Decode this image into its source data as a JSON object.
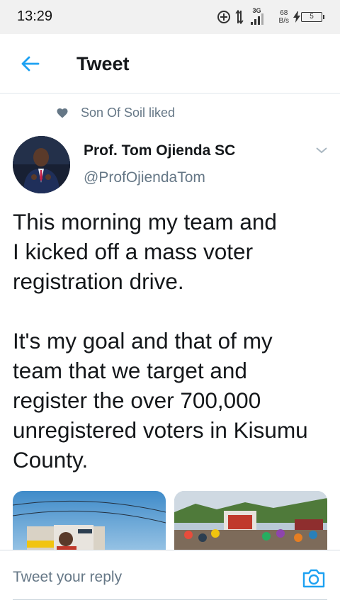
{
  "status_bar": {
    "time": "13:29",
    "network_type": "3G",
    "speed_value": "68",
    "speed_unit": "B/s",
    "battery_level": "5",
    "icons": [
      "data-saver-icon",
      "signal-arrows-icon",
      "signal-bars-icon",
      "charging-icon",
      "battery-icon"
    ]
  },
  "header": {
    "title": "Tweet",
    "back_icon": "arrow-left-icon",
    "accent_color": "#1da1f2"
  },
  "social_context": {
    "icon": "heart-icon",
    "text": "Son Of Soil liked"
  },
  "tweet": {
    "author_name": "Prof. Tom Ojienda SC",
    "author_handle": "@ProfOjiendaTom",
    "paragraphs": [
      [
        "This morning my team and",
        "I kicked off a mass voter",
        "registration drive."
      ],
      [
        "It's my goal and that of my",
        "team that we target and",
        "register the over 700,000",
        "unregistered voters in Kisumu",
        "County."
      ]
    ],
    "media_count": 2
  },
  "reply": {
    "placeholder": "Tweet your reply",
    "camera_icon": "camera-icon"
  },
  "colors": {
    "text_primary": "#14171a",
    "text_secondary": "#657786",
    "accent": "#1da1f2",
    "divider": "#e1e8ed"
  }
}
